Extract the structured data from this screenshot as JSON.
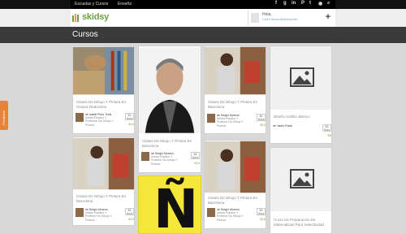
{
  "topbar": {
    "links": [
      "Escuelas y Cursos",
      "Enseña"
    ],
    "social_icons": [
      "facebook-icon",
      "google-plus-icon",
      "linkedin-icon",
      "pinterest-icon",
      "twitter-icon",
      "rss-icon",
      "search-icon"
    ]
  },
  "header": {
    "logo": "skidsy",
    "user_name": "Hola,",
    "user_sub": "Cobre Nueva Notificaciones"
  },
  "page_title": "Cursos",
  "feedback_tab": "Feedback",
  "cards": [
    {
      "title": "Clases De Dibujo Y Pintura En Grupos Reducidos",
      "teacher": "de Isabel Pinto Tonis",
      "teacher_sub": "Artista Plastico Y Profesora De Dibujo Y Pintura",
      "price": "€5",
      "price_sub": "Hora",
      "link": "€10"
    },
    {
      "title": "Clases De Dibujo Y Pintura En Barcelona",
      "teacher": "de Sergio Moreno",
      "teacher_sub": "Artista Plastico Y Profesor De Dibujo Y Pintura",
      "price": "€8",
      "price_sub": "Hora",
      "link": "€10"
    },
    {
      "title": "Clases De Dibujo Y Pintura En Barcelona",
      "teacher": "de Sergio Moreno",
      "teacher_sub": "Artista Plastico Y Profesor De Dibujo Y Pintura",
      "price": "€8",
      "price_sub": "Hora",
      "link": "€10"
    },
    {
      "title": "Diseño Gráfico Básico",
      "teacher": "de Javier Rubio",
      "teacher_sub": "",
      "price": "€8",
      "price_sub": "Hora",
      "link": "€5"
    },
    {
      "title": "Clases De Dibujo Y Pintura En Barcelona",
      "teacher": "de Sergio Moreno",
      "teacher_sub": "Artista Plastico Y Profesor De Dibujo Y Pintura",
      "price": "€8",
      "price_sub": "Hora",
      "link": "€10"
    },
    {
      "title": "",
      "glyph": "Ñ"
    },
    {
      "title": "Clases De Dibujo Y Pintura En Barcelona",
      "teacher": "de Sergio Moreno",
      "teacher_sub": "Artista Plastico Y Profesor De Dibujo Y Pintura",
      "price": "€8",
      "price_sub": "Hora",
      "link": "€10"
    },
    {
      "title": "Curso De Preparación De Matemáticas Para Selectividad",
      "teacher": "",
      "teacher_sub": "",
      "price": "",
      "price_sub": "",
      "link": ""
    }
  ]
}
